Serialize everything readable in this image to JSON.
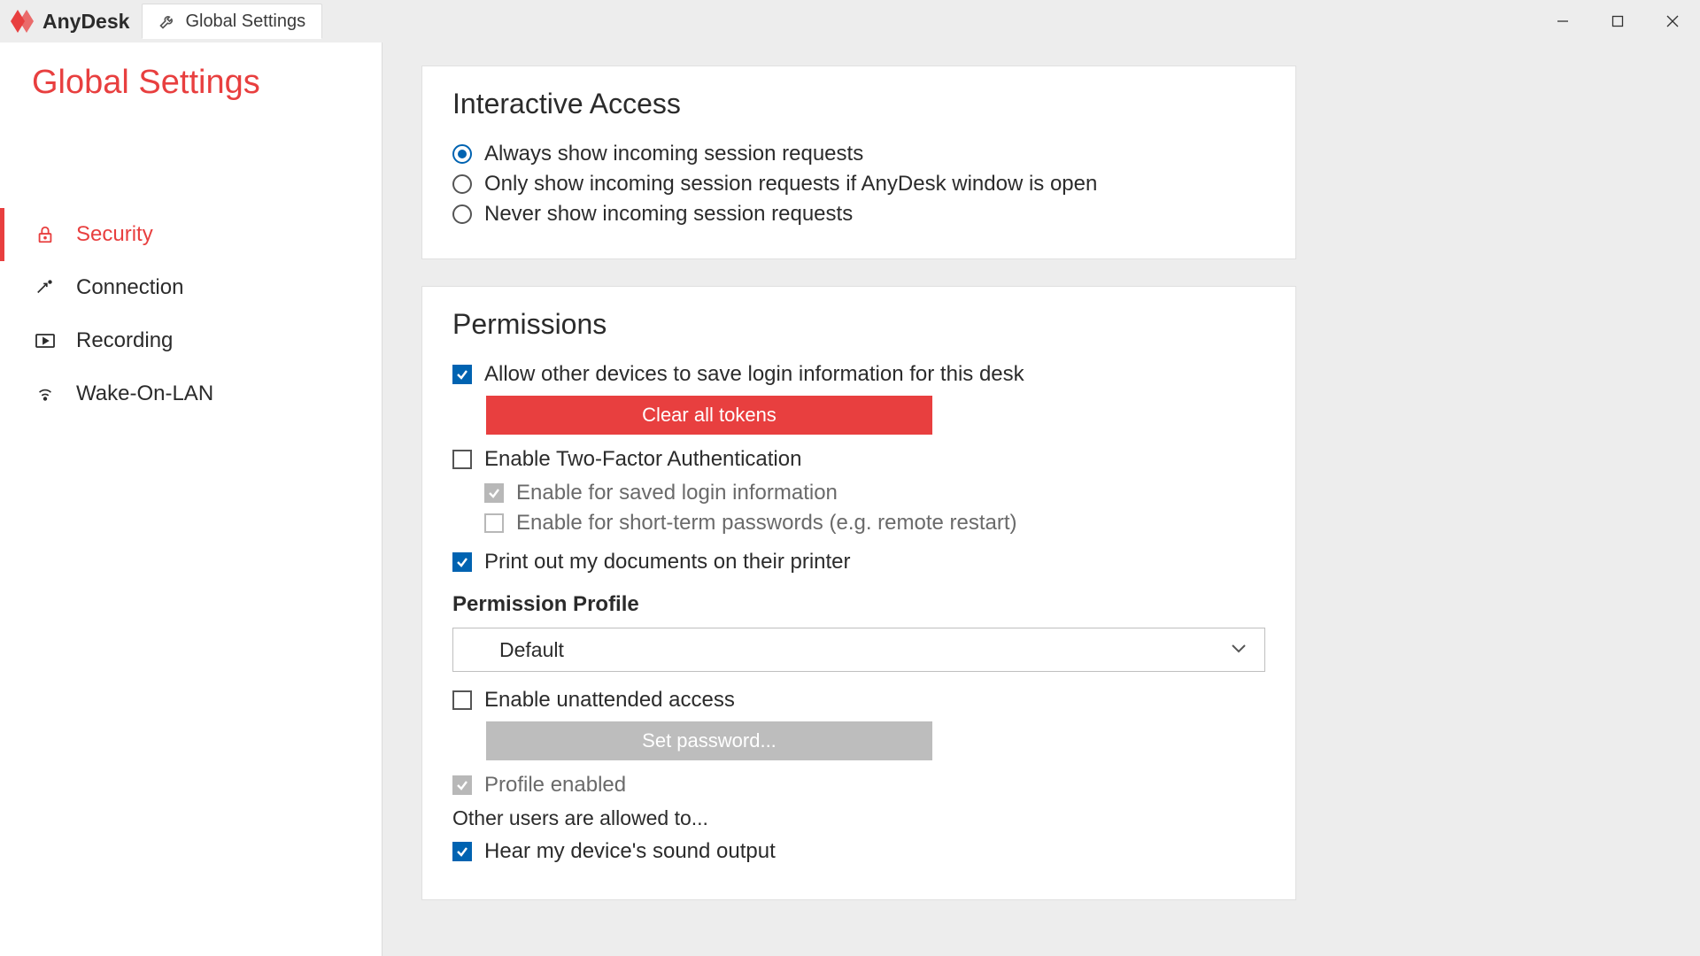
{
  "app": {
    "name": "AnyDesk"
  },
  "tab": {
    "label": "Global Settings"
  },
  "page": {
    "title": "Global Settings"
  },
  "sidebar": {
    "items": [
      {
        "label": "Security"
      },
      {
        "label": "Connection"
      },
      {
        "label": "Recording"
      },
      {
        "label": "Wake-On-LAN"
      }
    ]
  },
  "interactive": {
    "title": "Interactive Access",
    "options": [
      {
        "label": "Always show incoming session requests",
        "checked": true
      },
      {
        "label": "Only show incoming session requests if AnyDesk window is open",
        "checked": false
      },
      {
        "label": "Never show incoming session requests",
        "checked": false
      }
    ]
  },
  "permissions": {
    "title": "Permissions",
    "allow_save_login": {
      "label": "Allow other devices to save login information for this desk",
      "checked": true
    },
    "clear_tokens": "Clear all tokens",
    "enable_2fa": {
      "label": "Enable Two-Factor Authentication",
      "checked": false
    },
    "enable_2fa_saved": {
      "label": "Enable for saved login information",
      "checked": true,
      "disabled": true
    },
    "enable_2fa_short": {
      "label": "Enable for short-term passwords (e.g. remote restart)",
      "checked": false,
      "disabled": true
    },
    "print_docs": {
      "label": "Print out my documents on their printer",
      "checked": true
    },
    "profile_heading": "Permission Profile",
    "profile_value": "Default",
    "unattended": {
      "label": "Enable unattended access",
      "checked": false
    },
    "set_password": "Set password...",
    "profile_enabled": {
      "label": "Profile enabled",
      "checked": true,
      "disabled": true
    },
    "others_allowed": "Other users are allowed to...",
    "hear_sound": {
      "label": "Hear my device's sound output",
      "checked": true
    }
  }
}
